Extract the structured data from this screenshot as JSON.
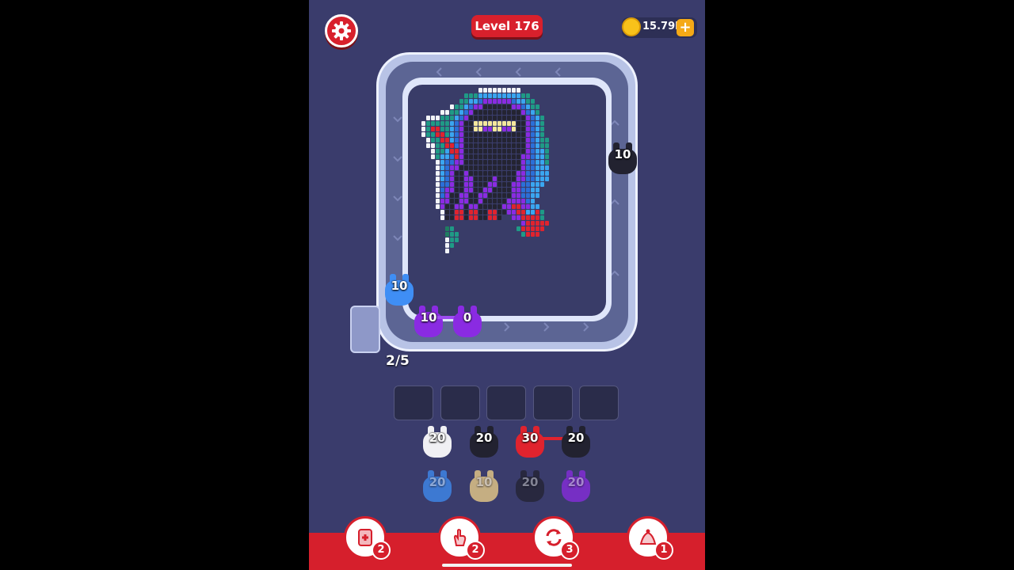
{
  "hud": {
    "level_label": "Level 176",
    "coins": "15.79k",
    "plus": "+"
  },
  "belt": {
    "counter": "2/5",
    "shooters": [
      {
        "value": "10",
        "color": "#3f8ef5"
      },
      {
        "value": "10",
        "color": "#8a2be2"
      },
      {
        "value": "0",
        "color": "#8a2be2"
      },
      {
        "value": "10",
        "color": "#222230"
      }
    ]
  },
  "queue": {
    "row1": [
      {
        "value": "20",
        "color": "#f0f0f4"
      },
      {
        "value": "20",
        "color": "#222230"
      },
      {
        "value": "30",
        "color": "#e0232e"
      },
      {
        "value": "20",
        "color": "#222230"
      }
    ],
    "row2": [
      {
        "value": "20",
        "color": "#3f8ef5"
      },
      {
        "value": "10",
        "color": "#f4d58a"
      },
      {
        "value": "20",
        "color": "#222230"
      },
      {
        "value": "20",
        "color": "#8a2be2"
      }
    ]
  },
  "boosters": [
    {
      "name": "add-slot",
      "count": "2"
    },
    {
      "name": "hand",
      "count": "2"
    },
    {
      "name": "shuffle",
      "count": "3"
    },
    {
      "name": "magic",
      "count": "1"
    }
  ],
  "colors": {
    "accent_red": "#d61f2c",
    "background": "#3a3c6c",
    "coin": "#f8c21a"
  }
}
